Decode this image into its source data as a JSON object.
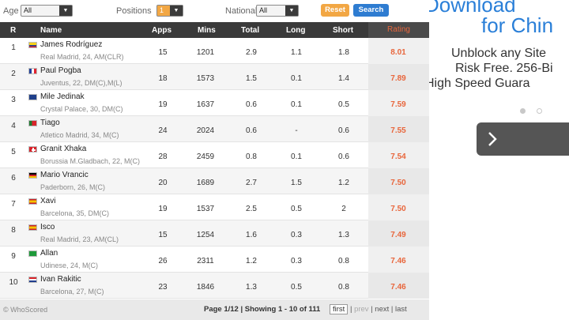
{
  "filters": {
    "age_label": "Age",
    "age_value": "All",
    "positions_label": "Positions",
    "positions_value": "1",
    "nationality_label": "Nationality",
    "nationality_value": "All",
    "reset_label": "Reset",
    "search_label": "Search"
  },
  "table": {
    "headers": {
      "rank": "R",
      "name": "Name",
      "apps": "Apps",
      "mins": "Mins",
      "total": "Total",
      "long": "Long",
      "short": "Short",
      "rating": "Rating"
    },
    "rows": [
      {
        "rank": "1",
        "name": "James Rodríguez",
        "detail": "Real Madrid, 24, AM(CLR)",
        "flag": "colombia-flag",
        "apps": "15",
        "mins": "1201",
        "total": "2.9",
        "long": "1.1",
        "short": "1.8",
        "rating": "8.01"
      },
      {
        "rank": "2",
        "name": "Paul Pogba",
        "detail": "Juventus, 22, DM(C),M(L)",
        "flag": "france-flag",
        "apps": "18",
        "mins": "1573",
        "total": "1.5",
        "long": "0.1",
        "short": "1.4",
        "rating": "7.89"
      },
      {
        "rank": "3",
        "name": "Mile Jedinak",
        "detail": "Crystal Palace, 30, DM(C)",
        "flag": "australia-flag",
        "apps": "19",
        "mins": "1637",
        "total": "0.6",
        "long": "0.1",
        "short": "0.5",
        "rating": "7.59"
      },
      {
        "rank": "4",
        "name": "Tiago",
        "detail": "Atletico Madrid, 34, M(C)",
        "flag": "portugal-flag",
        "apps": "24",
        "mins": "2024",
        "total": "0.6",
        "long": "-",
        "short": "0.6",
        "rating": "7.55"
      },
      {
        "rank": "5",
        "name": "Granit Xhaka",
        "detail": "Borussia M.Gladbach, 22, M(C)",
        "flag": "switzerland-flag",
        "apps": "28",
        "mins": "2459",
        "total": "0.8",
        "long": "0.1",
        "short": "0.6",
        "rating": "7.54"
      },
      {
        "rank": "6",
        "name": "Mario Vrancic",
        "detail": "Paderborn, 26, M(C)",
        "flag": "germany-flag",
        "apps": "20",
        "mins": "1689",
        "total": "2.7",
        "long": "1.5",
        "short": "1.2",
        "rating": "7.50"
      },
      {
        "rank": "7",
        "name": "Xavi",
        "detail": "Barcelona, 35, DM(C)",
        "flag": "spain-flag",
        "apps": "19",
        "mins": "1537",
        "total": "2.5",
        "long": "0.5",
        "short": "2",
        "rating": "7.50"
      },
      {
        "rank": "8",
        "name": "Isco",
        "detail": "Real Madrid, 23, AM(CL)",
        "flag": "spain-flag",
        "apps": "15",
        "mins": "1254",
        "total": "1.6",
        "long": "0.3",
        "short": "1.3",
        "rating": "7.49"
      },
      {
        "rank": "9",
        "name": "Allan",
        "detail": "Udinese, 24, M(C)",
        "flag": "brazil-flag",
        "apps": "26",
        "mins": "2311",
        "total": "1.2",
        "long": "0.3",
        "short": "0.8",
        "rating": "7.46"
      },
      {
        "rank": "10",
        "name": "Ivan Rakitic",
        "detail": "Barcelona, 27, M(C)",
        "flag": "croatia-flag",
        "apps": "23",
        "mins": "1846",
        "total": "1.3",
        "long": "0.5",
        "short": "0.8",
        "rating": "7.46"
      }
    ]
  },
  "footer": {
    "copyright": "© WhoScored",
    "page_info": "Page 1/12 | Showing 1 - 10 of 111",
    "first": "first",
    "sep1": " | ",
    "prev": "prev",
    "sep2": " | ",
    "next": "next",
    "sep3": " | ",
    "last": "last"
  },
  "ad": {
    "headline_1": "Download",
    "headline_2": "for Chin",
    "line_1": "Unblock any Site",
    "line_2": "Risk Free. 256-Bi",
    "line_3": "High Speed Guara",
    "next_icon": "chevron-right-icon",
    "accent_color": "#2a7fd8"
  },
  "colors": {
    "header_bg": "#3a3a3a",
    "rating": "#e8663c",
    "reset_button": "#f2a744",
    "search_button": "#2e7cd1"
  }
}
